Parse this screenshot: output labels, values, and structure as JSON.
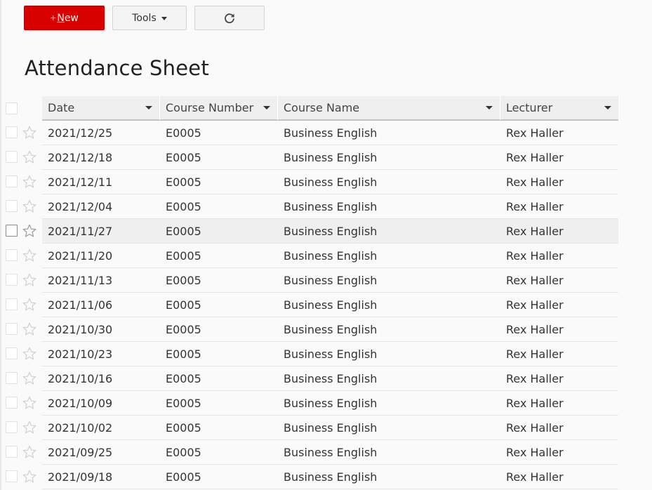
{
  "toolbar": {
    "new_plus": "+",
    "new_first": "N",
    "new_rest": "ew",
    "tools_label": "Tools"
  },
  "page_title": "Attendance Sheet",
  "columns": [
    "Date",
    "Course Number",
    "Course Name",
    "Lecturer"
  ],
  "rows": [
    {
      "date": "2021/12/25",
      "course_number": "E0005",
      "course_name": "Business English",
      "lecturer": "Rex Haller"
    },
    {
      "date": "2021/12/18",
      "course_number": "E0005",
      "course_name": "Business English",
      "lecturer": "Rex Haller"
    },
    {
      "date": "2021/12/11",
      "course_number": "E0005",
      "course_name": "Business English",
      "lecturer": "Rex Haller"
    },
    {
      "date": "2021/12/04",
      "course_number": "E0005",
      "course_name": "Business English",
      "lecturer": "Rex Haller"
    },
    {
      "date": "2021/11/27",
      "course_number": "E0005",
      "course_name": "Business English",
      "lecturer": "Rex Haller"
    },
    {
      "date": "2021/11/20",
      "course_number": "E0005",
      "course_name": "Business English",
      "lecturer": "Rex Haller"
    },
    {
      "date": "2021/11/13",
      "course_number": "E0005",
      "course_name": "Business English",
      "lecturer": "Rex Haller"
    },
    {
      "date": "2021/11/06",
      "course_number": "E0005",
      "course_name": "Business English",
      "lecturer": "Rex Haller"
    },
    {
      "date": "2021/10/30",
      "course_number": "E0005",
      "course_name": "Business English",
      "lecturer": "Rex Haller"
    },
    {
      "date": "2021/10/23",
      "course_number": "E0005",
      "course_name": "Business English",
      "lecturer": "Rex Haller"
    },
    {
      "date": "2021/10/16",
      "course_number": "E0005",
      "course_name": "Business English",
      "lecturer": "Rex Haller"
    },
    {
      "date": "2021/10/09",
      "course_number": "E0005",
      "course_name": "Business English",
      "lecturer": "Rex Haller"
    },
    {
      "date": "2021/10/02",
      "course_number": "E0005",
      "course_name": "Business English",
      "lecturer": "Rex Haller"
    },
    {
      "date": "2021/09/25",
      "course_number": "E0005",
      "course_name": "Business English",
      "lecturer": "Rex Haller"
    },
    {
      "date": "2021/09/18",
      "course_number": "E0005",
      "course_name": "Business English",
      "lecturer": "Rex Haller"
    }
  ],
  "hovered_row": 4,
  "icons": {
    "refresh": "refresh-icon",
    "star": "star-icon",
    "caret": "caret-down-icon"
  },
  "colors": {
    "primary": "#d90000",
    "header_bg": "#efefef",
    "hover_bg": "#efefef"
  }
}
